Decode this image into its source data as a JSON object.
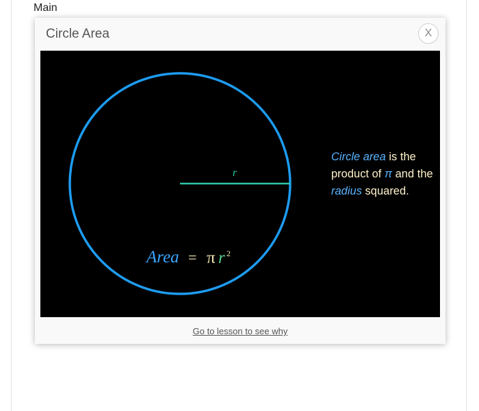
{
  "page": {
    "main_label": "Main"
  },
  "modal": {
    "title": "Circle Area",
    "close_label": "X",
    "link_label": "Go to lesson to see why"
  },
  "figure": {
    "radius_label": "r",
    "formula": {
      "area_word": "Area",
      "equals": "=",
      "pi": "π",
      "r": "r",
      "exponent": "2"
    },
    "caption": {
      "part1": "Circle area",
      "part2": " is the product of ",
      "part3": "π",
      "part4": " and the ",
      "part5": "radius",
      "part6": " squared."
    },
    "colors": {
      "circle": "#1e9bf0",
      "radius_line": "#2ec4a7",
      "area_word": "#3aa6ff",
      "pi": "#f5e6b3",
      "r": "#54d08e",
      "caption_text": "#fff2cc",
      "caption_highlight": "#5ab3ff",
      "background": "#000000"
    }
  }
}
